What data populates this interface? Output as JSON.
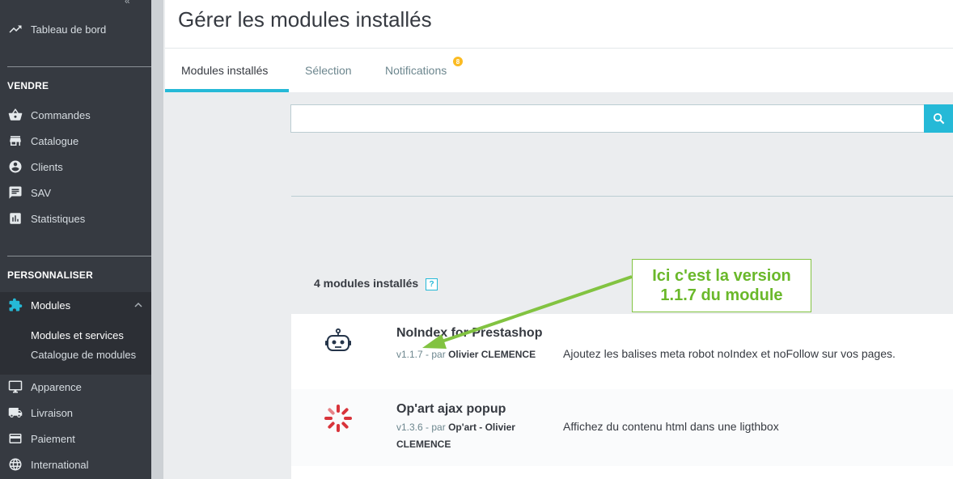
{
  "sidebar": {
    "dashboard": "Tableau de bord",
    "section_sell": "VENDRE",
    "sell_items": [
      "Commandes",
      "Catalogue",
      "Clients",
      "SAV",
      "Statistiques"
    ],
    "section_customize": "PERSONNALISER",
    "modules": "Modules",
    "submenu": [
      "Modules et services",
      "Catalogue de modules"
    ],
    "more_items": [
      "Apparence",
      "Livraison",
      "Paiement",
      "International"
    ]
  },
  "header": {
    "title": "Gérer les modules installés",
    "tabs": [
      "Modules installés",
      "Sélection",
      "Notifications"
    ],
    "notifications_badge": "8"
  },
  "search": {
    "placeholder": ""
  },
  "list": {
    "count_label": "4 modules installés",
    "help_label": "?"
  },
  "modules": [
    {
      "name": "NoIndex for Prestashop",
      "version": "v1.1.7",
      "by": "- par",
      "author": "Olivier CLEMENCE",
      "description": "Ajoutez les balises meta robot noIndex et noFollow sur vos pages."
    },
    {
      "name": "Op'art ajax popup",
      "version": "v1.3.6",
      "by": "- par",
      "author": "Op'art - Olivier CLEMENCE",
      "description": "Affichez du contenu html dans une ligthbox"
    }
  ],
  "annotation": {
    "line1": "Ici c'est la version",
    "line2": "1.1.7 du module"
  },
  "colors": {
    "sidebar_bg": "#363a41",
    "accent": "#25b9d7",
    "badge": "#fbbb22",
    "annotation_green": "#6ab82a"
  }
}
